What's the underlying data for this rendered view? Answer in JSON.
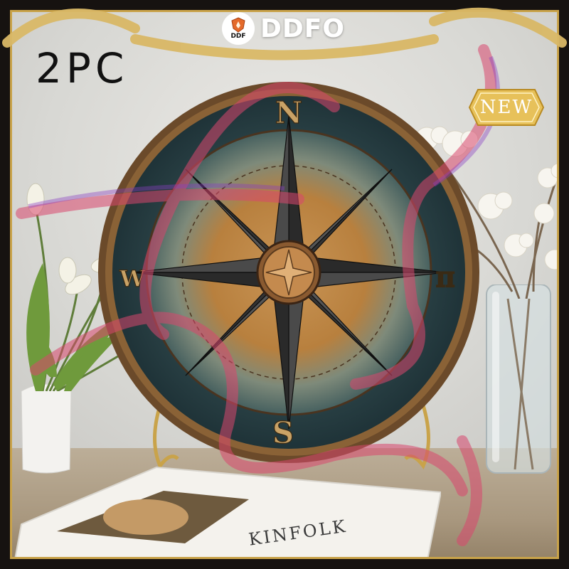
{
  "brand": {
    "logo_text": "DDF",
    "name": "DDFO",
    "logo_icon": "shield-crest-icon"
  },
  "product": {
    "count_label": "2PC",
    "badge_label": "NEW"
  },
  "compass": {
    "north": "N",
    "south": "S",
    "west": "W"
  },
  "scene": {
    "book_cover_word": "KINFOLK"
  },
  "colors": {
    "frame": "#161210",
    "gold_trim": "#c9a34a",
    "plaque_rim": "#6b4a2a",
    "plaque_dark": "#1f3338",
    "rust": "#b8803e",
    "ribbon": "#d9476e",
    "badge_gold": "#e7c15a"
  }
}
